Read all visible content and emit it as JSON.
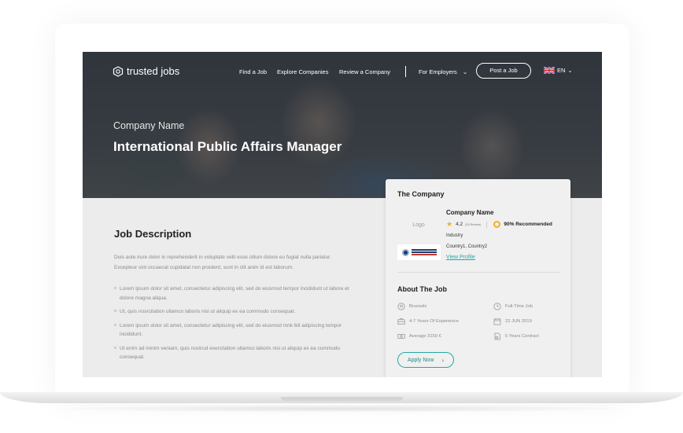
{
  "brand": {
    "name": "trusted jobs"
  },
  "nav": {
    "links": [
      "Find a Job",
      "Explore Companies",
      "Review a Company"
    ],
    "employers": "For Employers",
    "post_job": "Post a Job",
    "language": "EN"
  },
  "hero": {
    "company": "Company Name",
    "title": "International Public Affairs Manager"
  },
  "job_description": {
    "heading": "Job Description",
    "paragraph": "Duis aute irure dolor in reprehenderit in voluptate velit esse cillum dolore eu fugiat nulla pariatur. Excepteur sint occaecat cupidatat non proident, sunt in clit anim id est laborum.",
    "bullets": [
      "Lorem ipsum dolor sit amet, consectetur adipiscing elit, sed do eiusmod tempor incididunt ut labore et dolore magna aliqua.",
      "Ut, quis nosrcitation ullamco laboris nisi ut aliquip ex ea commodo consequat.",
      "Lorem ipsum dolor sit amet, consectetur adipiscing elit, sed do eiusmod mnk lkll adipiscing tempor incididunt.",
      "Ut enim ad minim veniam, quis nostrud exercitation ullamco laboris nisi ut aliquip ex ea commodo consequat."
    ]
  },
  "company_card": {
    "heading": "The Company",
    "logo_placeholder": "Logo",
    "name": "Company Name",
    "rating": "4,2",
    "review_count": "(33 Review)",
    "recommended": "90% Recommended",
    "industry": "Industry",
    "countries": "Country1, Country2",
    "profile_link": "View Profile"
  },
  "about_job": {
    "heading": "About The Job",
    "location": "Brussels",
    "contract_type": "Full-Time Job",
    "experience": "4-7 Years Of Experience",
    "date": "22 JUN 2019",
    "salary": "Average  3150 €",
    "duration": "5 Years Contract",
    "apply": "Apply Now"
  },
  "colors": {
    "accent": "#27a8a2",
    "star": "#f2b01e",
    "hero_overlay": "#2a2e34"
  }
}
